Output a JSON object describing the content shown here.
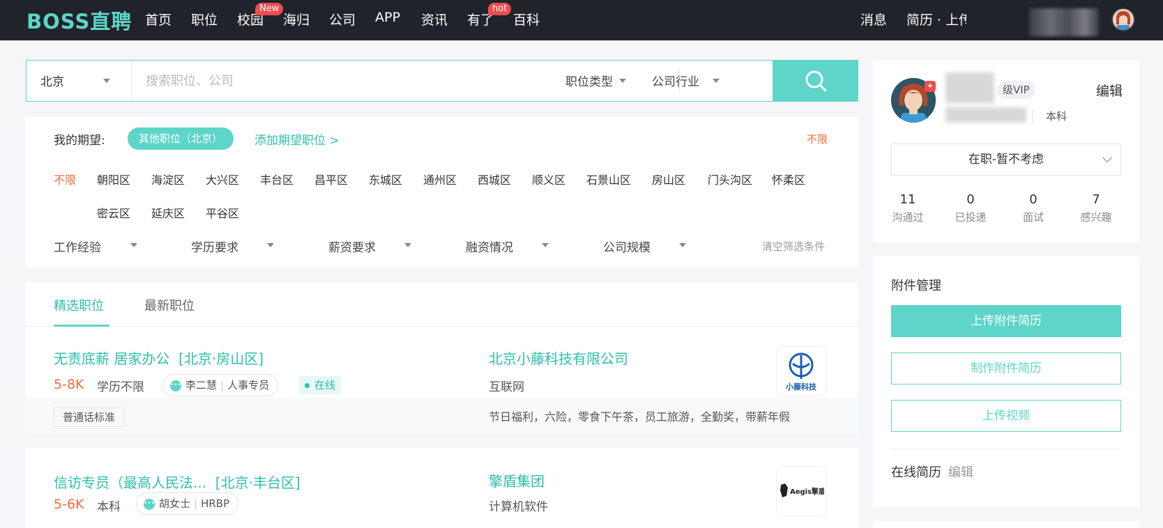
{
  "header": {
    "logo": "BOSS直聘",
    "nav": [
      {
        "label": "首页"
      },
      {
        "label": "职位"
      },
      {
        "label": "校园",
        "badge": "New"
      },
      {
        "label": "海归"
      },
      {
        "label": "公司"
      },
      {
        "label": "APP"
      },
      {
        "label": "资讯"
      },
      {
        "label": "有了",
        "badge": "hot"
      },
      {
        "label": "百科"
      }
    ],
    "messages": "消息",
    "resume_upload": "简历 · 上传"
  },
  "search": {
    "city": "北京",
    "placeholder": "搜索职位、公司",
    "job_type": "职位类型",
    "industry": "公司行业"
  },
  "filter": {
    "expect_label": "我的期望:",
    "expect_chip": "其他职位（北京）",
    "add_expect": "添加期望职位 >",
    "no_limit_right": "不限",
    "districts": [
      "不限",
      "朝阳区",
      "海淀区",
      "大兴区",
      "丰台区",
      "昌平区",
      "东城区",
      "通州区",
      "西城区",
      "顺义区",
      "石景山区",
      "房山区",
      "门头沟区",
      "怀柔区",
      "密云区",
      "延庆区",
      "平谷区"
    ],
    "conditions": [
      "工作经验",
      "学历要求",
      "薪资要求",
      "融资情况",
      "公司规模"
    ],
    "clear": "清空筛选条件"
  },
  "tabs": [
    "精选职位",
    "最新职位"
  ],
  "jobs": [
    {
      "title": "无责底薪 居家办公",
      "location": "[北京·房山区]",
      "salary": "5-8K",
      "education": "学历不限",
      "hr_name": "李二慧",
      "hr_title": "人事专员",
      "online": "在线",
      "company": "北京小藤科技有限公司",
      "industry": "互联网",
      "logo_text": "小藤科技",
      "tag": "普通话标准",
      "benefits": "节日福利，六险，零食下午茶，员工旅游，全勤奖，带薪年假"
    },
    {
      "title": "信访专员（最高人民法...",
      "location": "[北京·丰台区]",
      "salary": "5-6K",
      "education": "本科",
      "hr_name": "胡女士",
      "hr_title": "HRBP",
      "company": "擎盾集团",
      "industry": "计算机软件",
      "logo_text": "Aegis擎盾"
    }
  ],
  "profile": {
    "vip": "级VIP",
    "edit": "编辑",
    "degree": "本科",
    "status": "在职-暂不考虑",
    "stats": [
      {
        "num": "11",
        "label": "沟通过"
      },
      {
        "num": "0",
        "label": "已投递"
      },
      {
        "num": "0",
        "label": "面试"
      },
      {
        "num": "7",
        "label": "感兴趣"
      }
    ]
  },
  "attachments": {
    "title": "附件管理",
    "upload": "上传附件简历",
    "make": "制作附件简历",
    "video": "上传视频",
    "online_resume": "在线简历",
    "online_edit": "编辑"
  },
  "colors": {
    "accent": "#5dd5c8",
    "salary": "#f26d3d",
    "header": "#202329"
  }
}
